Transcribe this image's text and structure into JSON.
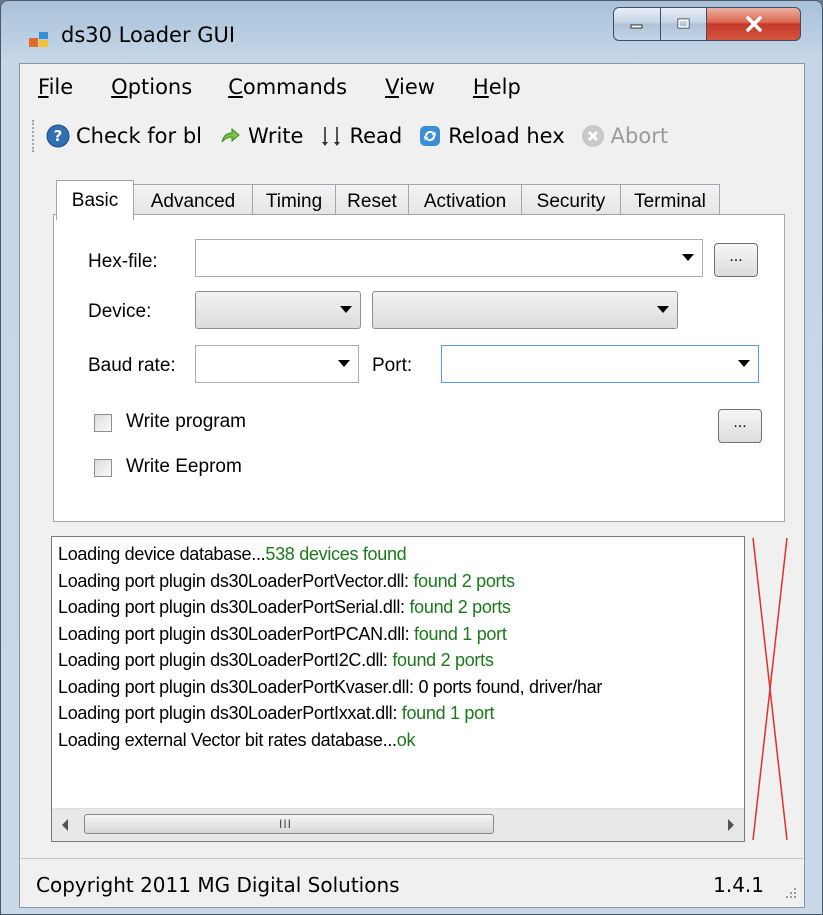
{
  "window": {
    "title": "ds30 Loader GUI",
    "icon": "app-window-icon",
    "controls": [
      "minimize-icon",
      "maximize-icon",
      "close-icon"
    ]
  },
  "menu": {
    "file": {
      "accel": "F",
      "rest": "ile"
    },
    "options": {
      "accel": "O",
      "rest": "ptions"
    },
    "commands": {
      "accel": "C",
      "rest": "ommands"
    },
    "view": {
      "accel": "V",
      "rest": "iew"
    },
    "help": {
      "accel": "H",
      "rest": "elp"
    }
  },
  "toolbar": {
    "check": {
      "label": "Check for bl",
      "icon": "help-circle-icon"
    },
    "write": {
      "label": "Write",
      "icon": "write-arrow-icon"
    },
    "read": {
      "label": "Read",
      "icon": "read-icon"
    },
    "reload": {
      "label": "Reload hex",
      "icon": "reload-icon"
    },
    "abort": {
      "label": "Abort",
      "icon": "abort-icon",
      "disabled": true
    }
  },
  "tabs": [
    "Basic",
    "Advanced",
    "Timing",
    "Reset",
    "Activation",
    "Security",
    "Terminal"
  ],
  "active_tab": "Basic",
  "basic": {
    "hexfile_label": "Hex-file:",
    "hexfile_value": "",
    "device_label": "Device:",
    "device_family": "",
    "device_model": "",
    "baud_label": "Baud rate:",
    "baud_value": "",
    "port_label": "Port:",
    "port_value": "",
    "browse_label": "...",
    "write_program_label": "Write program",
    "write_program_checked": false,
    "write_eeprom_label": "Write Eeprom",
    "write_eeprom_checked": false,
    "program_opts_label": "..."
  },
  "log": {
    "lines": [
      {
        "text": "Loading device database...",
        "result": "538 devices found"
      },
      {
        "text": "Loading port plugin ds30LoaderPortVector.dll: ",
        "result": "found 2 ports"
      },
      {
        "text": "Loading port plugin ds30LoaderPortSerial.dll: ",
        "result": "found 2 ports"
      },
      {
        "text": "Loading port plugin ds30LoaderPortPCAN.dll: ",
        "result": "found 1 port"
      },
      {
        "text": "Loading port plugin ds30LoaderPortI2C.dll: ",
        "result": "found 2 ports"
      },
      {
        "text": "Loading port plugin ds30LoaderPortKvaser.dll: 0 ports found, driver/har",
        "result": ""
      },
      {
        "text": "Loading port plugin ds30LoaderPortIxxat.dll: ",
        "result": "found 1 port"
      },
      {
        "text": "Loading external Vector bit rates database...",
        "result": "ok"
      }
    ],
    "scroll_grip": "III",
    "result_color": "#1a7a1a"
  },
  "status": {
    "copyright": "Copyright 2011 MG Digital Solutions",
    "version": "1.4.1"
  }
}
